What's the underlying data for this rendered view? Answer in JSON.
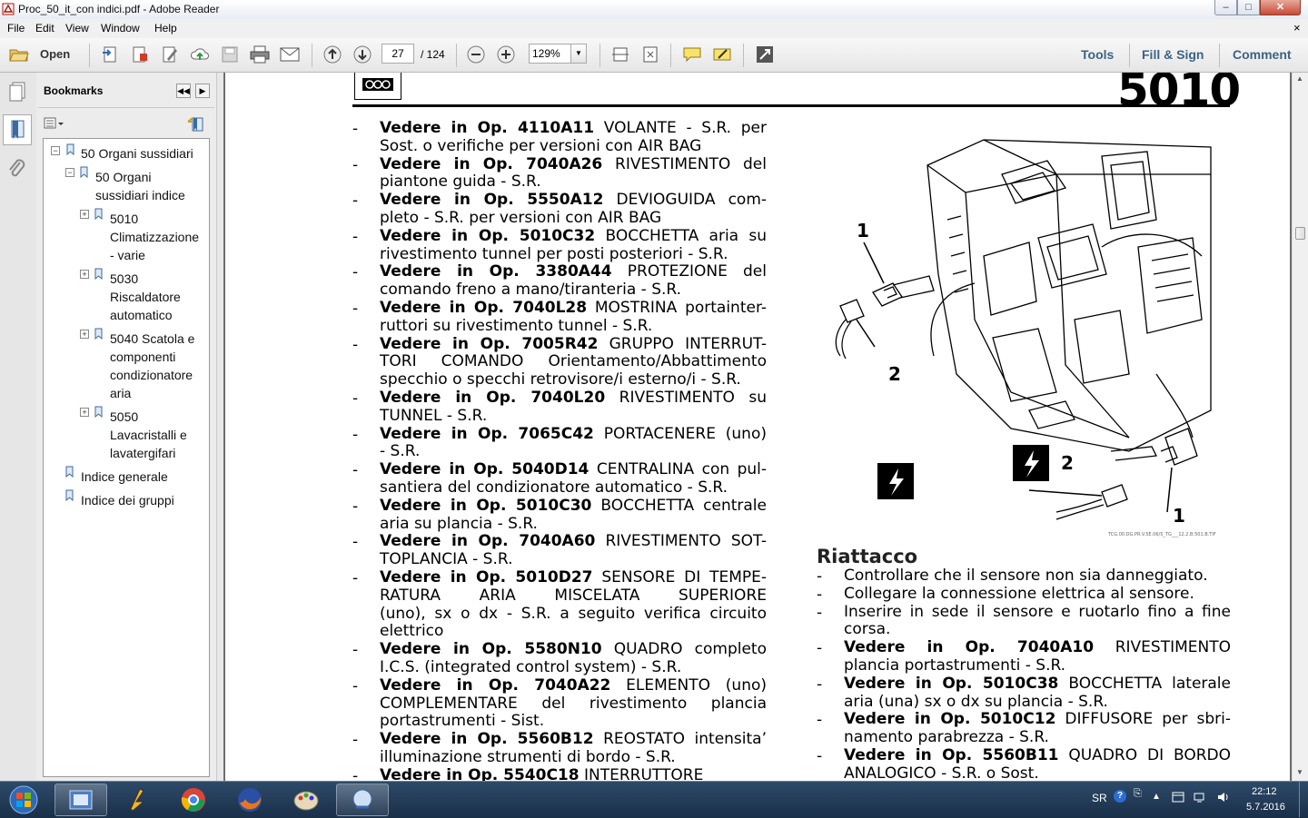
{
  "window": {
    "title": "Proc_50_it_con indici.pdf - Adobe Reader",
    "controls": [
      "–",
      "□",
      "✕"
    ]
  },
  "menu": {
    "items": [
      "File",
      "Edit",
      "View",
      "Window",
      "Help"
    ],
    "close_doc": "×"
  },
  "toolbar": {
    "open_label": "Open",
    "page_current": "27",
    "page_total": "/ 124",
    "zoom": "129%",
    "tools": "Tools",
    "fill_sign": "Fill & Sign",
    "comment": "Comment"
  },
  "bookmarks": {
    "header": "Bookmarks",
    "items": [
      {
        "label_lines": [
          "50 Organi sussidiari"
        ],
        "expander": "−"
      },
      {
        "label_lines": [
          "50 Organi",
          "sussidiari indice"
        ],
        "expander": "−"
      },
      {
        "label_lines": [
          "5010",
          "Climatizzazione",
          "- varie"
        ],
        "expander": "+"
      },
      {
        "label_lines": [
          "5030",
          "Riscaldatore",
          "automatico"
        ],
        "expander": "+"
      },
      {
        "label_lines": [
          "5040 Scatola e",
          "componenti",
          "condizionatore",
          "aria"
        ],
        "expander": "+"
      },
      {
        "label_lines": [
          "5050",
          "Lavacristalli e",
          "lavatergifari"
        ],
        "expander": "+"
      },
      {
        "label_lines": [
          "Indice generale"
        ],
        "expander": ""
      },
      {
        "label_lines": [
          "Indice dei gruppi"
        ],
        "expander": ""
      }
    ]
  },
  "page": {
    "section_number": "5010",
    "operations": [
      {
        "lines": [
          [
            "Vedere in Op. 4110A11",
            " VOLANTE - S.R. per"
          ],
          [
            "",
            "Sost. o verifiche per versioni con AIR BAG"
          ]
        ]
      },
      {
        "lines": [
          [
            "Vedere in Op. 7040A26",
            " RIVESTIMENTO del"
          ],
          [
            "",
            "piantone guida - S.R."
          ]
        ]
      },
      {
        "lines": [
          [
            "Vedere in Op. 5550A12",
            " DEVIOGUIDA com-"
          ],
          [
            "",
            "pleto - S.R. per versioni con AIR BAG"
          ]
        ]
      },
      {
        "lines": [
          [
            "Vedere in Op. 5010C32",
            " BOCCHETTA aria su"
          ],
          [
            "",
            "rivestimento tunnel per posti posteriori - S.R."
          ]
        ]
      },
      {
        "lines": [
          [
            "Vedere in Op. 3380A44",
            " PROTEZIONE del"
          ],
          [
            "",
            "comando freno a mano/tiranteria - S.R."
          ]
        ]
      },
      {
        "lines": [
          [
            "Vedere in Op. 7040L28",
            " MOSTRINA portainter-"
          ],
          [
            "",
            "ruttori su rivestimento tunnel - S.R."
          ]
        ]
      },
      {
        "lines": [
          [
            "Vedere in Op. 7005R42",
            " GRUPPO INTERRUT-"
          ],
          [
            "",
            "TORI COMANDO Orientamento/Abbattimento"
          ],
          [
            "",
            "specchio o specchi retrovisore/i esterno/i - S.R."
          ]
        ]
      },
      {
        "lines": [
          [
            "Vedere in Op. 7040L20",
            " RIVESTIMENTO su"
          ],
          [
            "",
            "TUNNEL - S.R."
          ]
        ]
      },
      {
        "lines": [
          [
            "Vedere in Op. 7065C42",
            " PORTACENERE (uno)"
          ],
          [
            "",
            "- S.R."
          ]
        ]
      },
      {
        "lines": [
          [
            "Vedere in Op. 5040D14",
            " CENTRALINA con pul-"
          ],
          [
            "",
            "santiera del condizionatore automatico - S.R."
          ]
        ]
      },
      {
        "lines": [
          [
            "Vedere in Op. 5010C30",
            " BOCCHETTA centrale"
          ],
          [
            "",
            "aria su plancia - S.R."
          ]
        ]
      },
      {
        "lines": [
          [
            "Vedere in Op. 7040A60",
            " RIVESTIMENTO SOT-"
          ],
          [
            "",
            "TOPLANCIA - S.R."
          ]
        ]
      },
      {
        "lines": [
          [
            "Vedere in Op. 5010D27",
            " SENSORE DI TEMPE-"
          ],
          [
            "",
            "RATURA ARIA MISCELATA SUPERIORE"
          ],
          [
            "",
            "(uno), sx o dx - S.R. a seguito verifica circuito"
          ],
          [
            "",
            "elettrico"
          ]
        ]
      },
      {
        "lines": [
          [
            "Vedere in Op. 5580N10",
            " QUADRO completo"
          ],
          [
            "",
            "I.C.S. (integrated control system) - S.R."
          ]
        ]
      },
      {
        "lines": [
          [
            "Vedere in Op. 7040A22",
            " ELEMENTO (uno)"
          ],
          [
            "",
            "COMPLEMENTARE del rivestimento plancia"
          ],
          [
            "",
            "portastrumenti - Sist."
          ]
        ]
      },
      {
        "lines": [
          [
            "Vedere in Op. 5560B12",
            " REOSTATO intensita’"
          ],
          [
            "",
            "illuminazione strumenti di bordo - S.R."
          ]
        ]
      },
      {
        "lines": [
          [
            "Vedere in Op. 5540C18",
            " INTERRUTTORE"
          ]
        ]
      }
    ],
    "figure": {
      "callouts": [
        "1",
        "2",
        "2",
        "1"
      ],
      "caption": "TCG.00.DG.PR.V.5E.06/5_TG___12.2.B.501.B.TIF"
    },
    "riattacco": {
      "title": "Riattacco",
      "items": [
        {
          "lines": [
            [
              "",
              "Controllare che il sensore non sia danneggiato."
            ]
          ]
        },
        {
          "lines": [
            [
              "",
              "Collegare la connessione elettrica al sensore."
            ]
          ]
        },
        {
          "lines": [
            [
              "",
              "Inserire in sede il sensore e ruotarlo fino a fine"
            ],
            [
              "",
              "corsa."
            ]
          ]
        },
        {
          "lines": [
            [
              "Vedere in Op. 7040A10",
              " RIVESTIMENTO"
            ],
            [
              "",
              "plancia portastrumenti - S.R."
            ]
          ]
        },
        {
          "lines": [
            [
              "Vedere in Op. 5010C38",
              " BOCCHETTA laterale"
            ],
            [
              "",
              "aria (una) sx o dx su plancia - S.R."
            ]
          ]
        },
        {
          "lines": [
            [
              "Vedere in Op. 5010C12",
              " DIFFUSORE per sbri-"
            ],
            [
              "",
              "namento parabrezza - S.R."
            ]
          ]
        },
        {
          "lines": [
            [
              "Vedere in Op. 5560B11",
              " QUADRO DI BORDO"
            ],
            [
              "",
              "ANALOGICO - S.R. o Sost."
            ]
          ]
        }
      ]
    }
  },
  "taskbar": {
    "lang": "SR",
    "time": "22:12",
    "date": "5.7.2016"
  },
  "colors": {
    "link_blue": "#3c6384",
    "taskbar": "#1f3653",
    "page_bg": "#ffffff",
    "doc_bg": "#6d6d6d"
  }
}
